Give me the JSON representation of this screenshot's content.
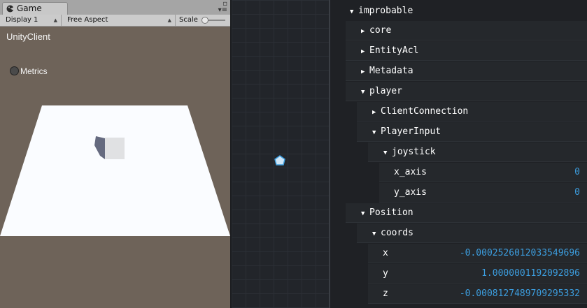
{
  "game_panel": {
    "tab_label": "Game",
    "toolbar": {
      "display": "Display 1",
      "aspect": "Free Aspect",
      "scale_label": "Scale"
    },
    "overlay_title": "UnityClient",
    "metrics_label": "Metrics"
  },
  "inspector": {
    "root": "improbable",
    "items": [
      {
        "label": "core",
        "state": "collapsed"
      },
      {
        "label": "EntityAcl",
        "state": "collapsed"
      },
      {
        "label": "Metadata",
        "state": "collapsed"
      },
      {
        "label": "player",
        "state": "expanded"
      },
      {
        "label": "ClientConnection",
        "state": "collapsed"
      },
      {
        "label": "PlayerInput",
        "state": "expanded"
      },
      {
        "label": "joystick",
        "state": "expanded"
      },
      {
        "label": "x_axis",
        "value": "0"
      },
      {
        "label": "y_axis",
        "value": "0"
      },
      {
        "label": "Position",
        "state": "expanded"
      },
      {
        "label": "coords",
        "state": "expanded"
      },
      {
        "label": "x",
        "value": "-0.0002526012033549696"
      },
      {
        "label": "y",
        "value": "1.0000001192092896"
      },
      {
        "label": "z",
        "value": "-0.0008127489709295332"
      }
    ]
  },
  "colors": {
    "value_blue": "#3c9dde",
    "ground": "#fafcff",
    "background_brown": "#6e6359"
  }
}
